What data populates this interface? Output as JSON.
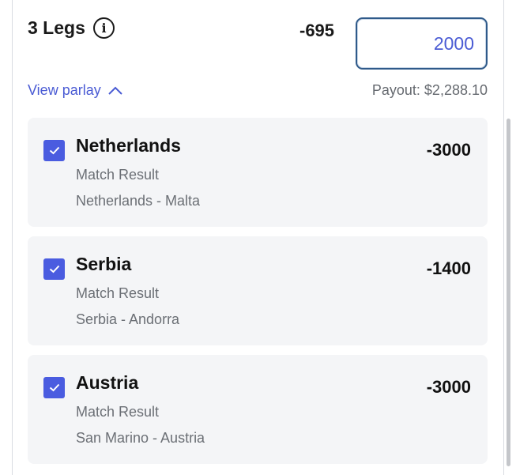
{
  "header": {
    "title": "3 Legs",
    "info_icon": "info-icon",
    "odds": "-695",
    "stake_value": "2000"
  },
  "parlay": {
    "toggle_label": "View parlay",
    "toggle_icon": "chevron-up-icon",
    "payout": "Payout: $2,288.10"
  },
  "legs": [
    {
      "team": "Netherlands",
      "odds": "-3000",
      "market": "Match Result",
      "event": "Netherlands - Malta",
      "checked": true
    },
    {
      "team": "Serbia",
      "odds": "-1400",
      "market": "Match Result",
      "event": "Serbia - Andorra",
      "checked": true
    },
    {
      "team": "Austria",
      "odds": "-3000",
      "market": "Match Result",
      "event": "San Marino - Austria",
      "checked": true
    }
  ],
  "colors": {
    "accent": "#4a5ce0",
    "link": "#4a5bd4",
    "card_bg": "#f4f5f7",
    "input_border": "#2f5a8a"
  }
}
